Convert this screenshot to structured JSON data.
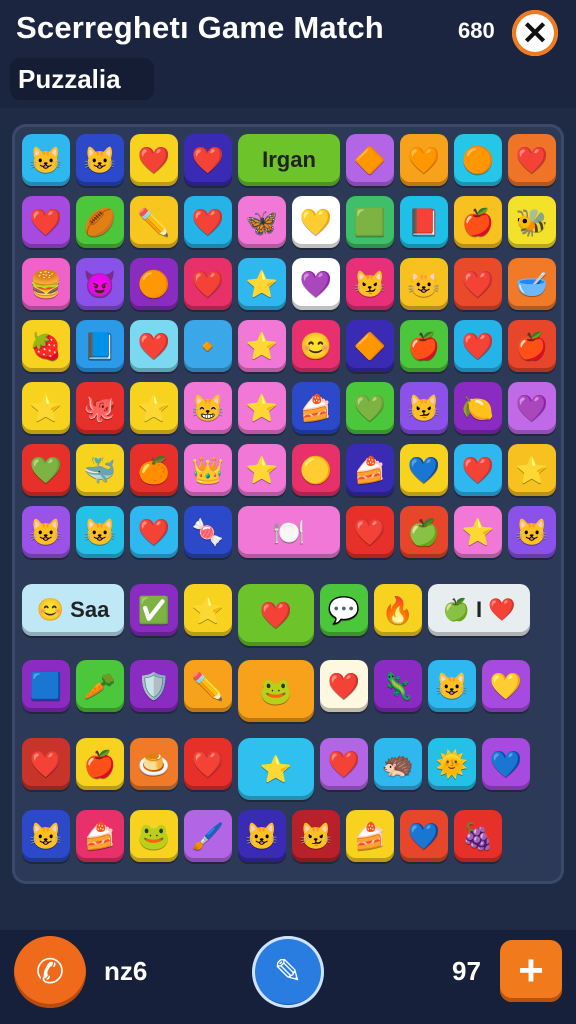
{
  "header": {
    "title": "Scerreghetı Game Match",
    "score": "680",
    "subtitle": "Puzzalia",
    "close_icon": "close-icon"
  },
  "board": {
    "rows": [
      [
        {
          "icon": "😺",
          "bg": "#2fb8f0"
        },
        {
          "icon": "😺",
          "bg": "#2b49c8"
        },
        {
          "icon": "❤️",
          "bg": "#f7d21f"
        },
        {
          "icon": "❤️",
          "bg": "#3a2bb5"
        },
        {
          "text": "Irgan",
          "bg": "#6cc42a",
          "wide": true
        },
        {
          "icon": "🔶",
          "bg": "#b266e6"
        },
        {
          "icon": "🧡",
          "bg": "#f7a21a"
        },
        {
          "icon": "🟠",
          "bg": "#26c6e8"
        },
        {
          "icon": "❤️",
          "bg": "#f07428"
        }
      ],
      [
        {
          "icon": "❤️",
          "bg": "#a64ae0"
        },
        {
          "icon": "🏉",
          "bg": "#4cc63a"
        },
        {
          "icon": "✏️",
          "bg": "#f7c61f"
        },
        {
          "icon": "❤️",
          "bg": "#25b3e8"
        },
        {
          "icon": "🦋",
          "bg": "#f178d6"
        },
        {
          "icon": "💛",
          "bg": "#ffffff"
        },
        {
          "icon": "🟩",
          "bg": "#3fbf6a"
        },
        {
          "icon": "📕",
          "bg": "#1fc0e8"
        },
        {
          "icon": "🍎",
          "bg": "#f7c21f"
        },
        {
          "icon": "🐝",
          "bg": "#f4e12a"
        }
      ],
      [
        {
          "icon": "🍔",
          "bg": "#ef62c8"
        },
        {
          "icon": "😈",
          "bg": "#8a52e8"
        },
        {
          "icon": "🟠",
          "bg": "#8a2bc2"
        },
        {
          "icon": "❤️",
          "bg": "#e8306a"
        },
        {
          "icon": "⭐",
          "bg": "#2fb8f0"
        },
        {
          "icon": "💜",
          "bg": "#ffffff"
        },
        {
          "icon": "😼",
          "bg": "#e8307a"
        },
        {
          "icon": "😺",
          "bg": "#f7c21f"
        },
        {
          "icon": "❤️",
          "bg": "#e84a2a"
        },
        {
          "icon": "🥣",
          "bg": "#f07a28"
        }
      ],
      [
        {
          "icon": "🍓",
          "bg": "#f7d21f"
        },
        {
          "icon": "📘",
          "bg": "#2b9ae8"
        },
        {
          "icon": "❤️",
          "bg": "#7ad8f0"
        },
        {
          "icon": "🔸",
          "bg": "#3aa8e8"
        },
        {
          "icon": "⭐",
          "bg": "#f178d6"
        },
        {
          "icon": "😊",
          "bg": "#e83070"
        },
        {
          "icon": "🔶",
          "bg": "#3a2bb5"
        },
        {
          "icon": "🍎",
          "bg": "#4cc63a"
        },
        {
          "icon": "❤️",
          "bg": "#25b3e8"
        },
        {
          "icon": "🍎",
          "bg": "#e8462a"
        }
      ],
      [
        {
          "icon": "⭐",
          "bg": "#f7d21f"
        },
        {
          "icon": "🐙",
          "bg": "#e8302a"
        },
        {
          "icon": "⭐",
          "bg": "#f7d21f"
        },
        {
          "icon": "😸",
          "bg": "#f178d6"
        },
        {
          "icon": "⭐",
          "bg": "#f178d6"
        },
        {
          "icon": "🍰",
          "bg": "#2b49c8"
        },
        {
          "icon": "💚",
          "bg": "#4cc63a"
        },
        {
          "icon": "😼",
          "bg": "#8a52e8"
        },
        {
          "icon": "🍋",
          "bg": "#8a2bc2"
        },
        {
          "icon": "💜",
          "bg": "#c06ae8"
        }
      ],
      [
        {
          "icon": "💚",
          "bg": "#e8302a"
        },
        {
          "icon": "🐳",
          "bg": "#f7d21f"
        },
        {
          "icon": "🍊",
          "bg": "#e8302a"
        },
        {
          "icon": "👑",
          "bg": "#f178d6"
        },
        {
          "icon": "⭐",
          "bg": "#f178d6"
        },
        {
          "icon": "🟡",
          "bg": "#e8306a"
        },
        {
          "icon": "🍰",
          "bg": "#3a2bb5"
        },
        {
          "icon": "💙",
          "bg": "#f7d21f"
        },
        {
          "icon": "❤️",
          "bg": "#2fb8f0"
        },
        {
          "icon": "⭐",
          "bg": "#f7c21f"
        }
      ],
      [
        {
          "icon": "😺",
          "bg": "#9a52e8"
        },
        {
          "icon": "😺",
          "bg": "#25c0e8"
        },
        {
          "icon": "❤️",
          "bg": "#2fb8f0"
        },
        {
          "icon": "🍬",
          "bg": "#2b49c8"
        },
        {
          "icon": "🍽️",
          "bg": "#f178d6",
          "wide": true
        },
        {
          "icon": "❤️",
          "bg": "#e8302a"
        },
        {
          "icon": "🍏",
          "bg": "#e8462a"
        },
        {
          "icon": "⭐",
          "bg": "#f178d6"
        },
        {
          "icon": "😺",
          "bg": "#8a52e8"
        }
      ],
      [
        {
          "text": "😊 Saa",
          "bg": "#bfe8f7",
          "wide": true
        },
        {
          "icon": "✅",
          "bg": "#8a2bc2"
        },
        {
          "icon": "⭐",
          "bg": "#f7d21f"
        },
        {
          "icon": "❤️",
          "bg": "#6cc42a",
          "big": true
        },
        {
          "icon": "💬",
          "bg": "#4cc63a"
        },
        {
          "icon": "🔥",
          "bg": "#f7d21f"
        },
        {
          "text": "🍏 I ❤️",
          "bg": "#e8eef0",
          "wide": true
        }
      ],
      [
        {
          "icon": "🟦",
          "bg": "#8a2bc2"
        },
        {
          "icon": "🥕",
          "bg": "#4cc63a"
        },
        {
          "icon": "🛡️",
          "bg": "#8a2bc2"
        },
        {
          "icon": "✏️",
          "bg": "#f7a21a"
        },
        {
          "icon": "🐸",
          "bg": "#f7a21a",
          "big": true
        },
        {
          "icon": "❤️",
          "bg": "#fff8e0"
        },
        {
          "icon": "🦎",
          "bg": "#8a2bc2"
        },
        {
          "icon": "😺",
          "bg": "#2fb8f0"
        },
        {
          "icon": "💛",
          "bg": "#a64ae0"
        }
      ],
      [
        {
          "icon": "❤️",
          "bg": "#c8342a"
        },
        {
          "icon": "🍎",
          "bg": "#f7d21f"
        },
        {
          "icon": "🍮",
          "bg": "#f07a28"
        },
        {
          "icon": "❤️",
          "bg": "#e8302a"
        },
        {
          "icon": "⭐",
          "bg": "#2fc0f0",
          "big": true
        },
        {
          "icon": "❤️",
          "bg": "#b266e6"
        },
        {
          "icon": "🦔",
          "bg": "#2fb8f0"
        },
        {
          "icon": "🌞",
          "bg": "#25c0e8"
        },
        {
          "icon": "💙",
          "bg": "#a64ae0"
        }
      ],
      [
        {
          "icon": "😺",
          "bg": "#2b49c8"
        },
        {
          "icon": "🍰",
          "bg": "#e8306a"
        },
        {
          "icon": "🐸",
          "bg": "#f7d21f"
        },
        {
          "icon": "🖌️",
          "bg": "#b266e6"
        },
        {
          "icon": "😺",
          "bg": "#3a2bb5"
        },
        {
          "icon": "😼",
          "bg": "#b8202a"
        },
        {
          "icon": "🍰",
          "bg": "#f7d21f"
        },
        {
          "icon": "💙",
          "bg": "#e8462a"
        },
        {
          "icon": "🍇",
          "bg": "#e8302a"
        }
      ]
    ]
  },
  "footer": {
    "phone_icon": "phone-icon",
    "moves_label": "nz6",
    "pencil_icon": "pencil-icon",
    "count": "97",
    "plus_icon": "plus-icon"
  }
}
